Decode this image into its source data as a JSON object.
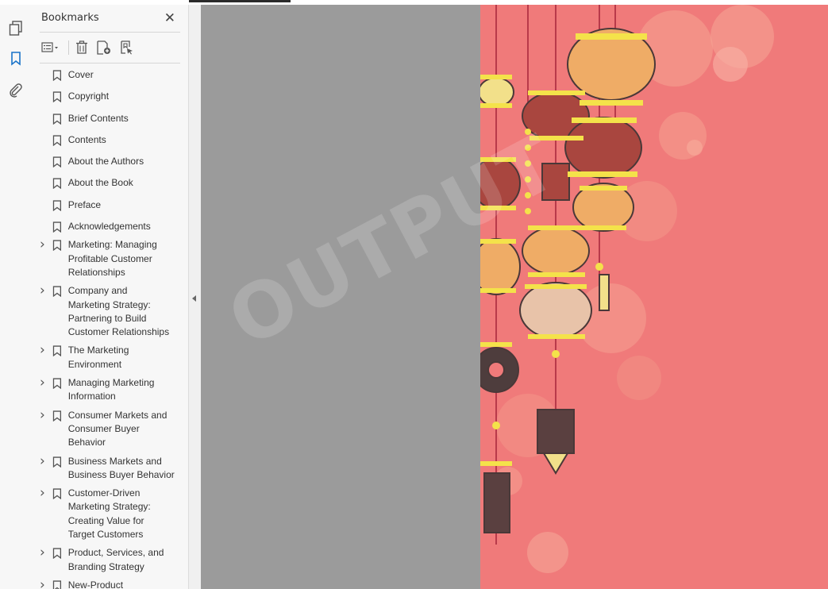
{
  "panel": {
    "title": "Bookmarks",
    "close_glyph": "✕"
  },
  "toolbar": {
    "options_icon": "options-menu-icon",
    "delete_icon": "delete-icon",
    "new_bookmark_icon": "new-bookmark-icon",
    "expand_bookmark_icon": "expand-current-bookmark-icon"
  },
  "rail": {
    "items": [
      "page-thumbnails-icon",
      "bookmarks-icon",
      "attachments-icon"
    ],
    "active": "bookmarks-icon"
  },
  "bookmarks": [
    {
      "label": "Cover",
      "expandable": false
    },
    {
      "label": "Copyright",
      "expandable": false
    },
    {
      "label": "Brief Contents",
      "expandable": false
    },
    {
      "label": "Contents",
      "expandable": false
    },
    {
      "label": "About the Authors",
      "expandable": false
    },
    {
      "label": "About the Book",
      "expandable": false
    },
    {
      "label": "Preface",
      "expandable": false
    },
    {
      "label": "Acknowledgements",
      "expandable": false
    },
    {
      "label": "Marketing: Managing Profitable Customer Relationships",
      "lines": [
        "Marketing: Managing",
        "Profitable Customer",
        "Relationships"
      ],
      "expandable": true
    },
    {
      "label": "Company and Marketing Strategy: Partnering to Build Customer Relationships",
      "lines": [
        "Company and",
        "Marketing Strategy:",
        "Partnering to Build",
        "Customer Relationships"
      ],
      "expandable": true
    },
    {
      "label": "The Marketing Environment",
      "lines": [
        "The Marketing",
        "Environment"
      ],
      "expandable": true
    },
    {
      "label": "Managing Marketing Information",
      "lines": [
        "Managing Marketing",
        "Information"
      ],
      "expandable": true
    },
    {
      "label": "Consumer Markets and Consumer Buyer Behavior",
      "lines": [
        "Consumer Markets and",
        "Consumer Buyer",
        "Behavior"
      ],
      "expandable": true
    },
    {
      "label": "Business Markets and Business Buyer Behavior",
      "lines": [
        "Business Markets and",
        "Business Buyer Behavior"
      ],
      "expandable": true
    },
    {
      "label": "Customer-Driven Marketing Strategy: Creating Value for Target Customers",
      "lines": [
        "Customer-Driven",
        "Marketing Strategy:",
        "Creating Value for",
        "Target Customers"
      ],
      "expandable": true
    },
    {
      "label": "Product, Services, and Branding Strategy",
      "lines": [
        "Product, Services, and",
        "Branding Strategy"
      ],
      "expandable": true
    },
    {
      "label": "New-Product",
      "lines": [
        "New-Product"
      ],
      "expandable": true
    }
  ],
  "document": {
    "watermark": "OUTPUT",
    "page_color": "#f07a7a",
    "gray_color": "#9b9b9b"
  },
  "colors": {
    "accent_blue": "#1a73c9"
  }
}
